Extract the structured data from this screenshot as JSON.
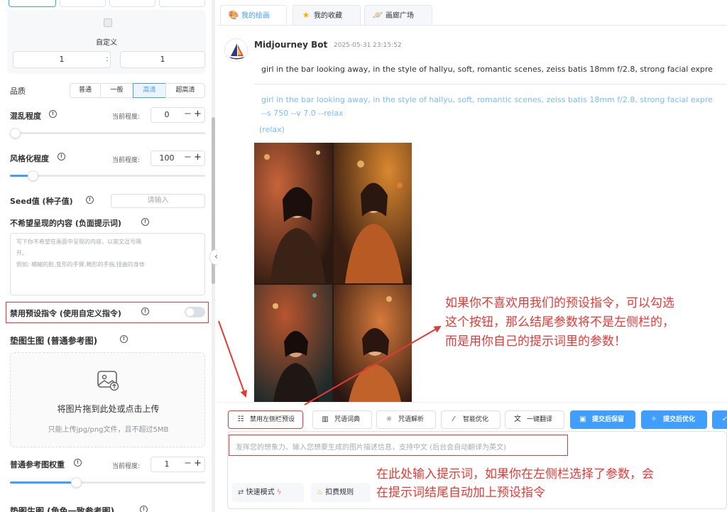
{
  "settings": {
    "custom_ratio": {
      "label": "自定义",
      "width": "1",
      "separator": ":",
      "height": "1"
    },
    "quality": {
      "label": "品质",
      "options": [
        "普通",
        "一般",
        "高清",
        "超高清"
      ],
      "selected": "高清"
    },
    "chaos": {
      "label": "混乱程度",
      "current_label": "当前程度:",
      "value": "0",
      "level": 0
    },
    "stylize": {
      "label": "风格化程度",
      "current_label": "当前程度:",
      "value": "100",
      "level": 0.1
    },
    "seed": {
      "label": "Seed值 (种子值)",
      "placeholder": "请输入"
    },
    "negative": {
      "label": "不希望呈现的内容 (负面提示词)",
      "placeholder_line1": "写下你不希望在画面中呈现的内容，以英文逗号隔",
      "placeholder_line2": "开。",
      "placeholder_line3": "例如: 模糊的脸,变形的手臂,畸形的手指,扭曲的身体"
    },
    "disable_preset": {
      "label": "禁用预设指令 (使用自定义指令)",
      "enabled": false
    },
    "ref_image": {
      "label": "垫图生图 (普通参考图)",
      "upload_title": "将图片拖到此处或点击上传",
      "upload_hint": "只能上传jpg/png文件，且不超过5MB"
    },
    "ref_weight": {
      "label": "普通参考图权重",
      "current_label": "当前程度:",
      "value": "1",
      "level": 0.33
    },
    "char_ref": {
      "label": "垫图生图 (角色一致参考图)"
    }
  },
  "tabs": [
    {
      "label": "我的绘画",
      "icon": "palette-icon",
      "active": true
    },
    {
      "label": "我的收藏",
      "icon": "star-icon",
      "active": false
    },
    {
      "label": "画廊广场",
      "icon": "planet-icon",
      "active": false
    }
  ],
  "message": {
    "author": "Midjourney Bot",
    "time": "2025-05-31 23:15:52",
    "prompt": "girl in the bar looking away, in the style of hallyu, soft, romantic scenes, zeiss batis 18mm f/2.8, strong facial expre",
    "prompt_full_line1": "girl in the bar looking away, in the style of hallyu, soft, romantic scenes, zeiss batis 18mm f/2.8, strong facial expre",
    "prompt_full_line2": "--s 750 --v 7.0 --relax",
    "mode": "(relax)"
  },
  "toolbar": {
    "disable_left_preset": "禁用左侧栏预设",
    "spell_dict": "咒语词典",
    "spell_parse": "咒语解析",
    "smart_optimize": "智能优化",
    "translate": "一键翻译",
    "submit_keep": "提交后保留",
    "submit_optimize": "提交后优化"
  },
  "composer": {
    "placeholder": "发挥您的想象力、输入您想要生成的图片描述信息，支持中文 (后台会自动翻译为英文)",
    "fast_mode": "快速模式",
    "billing": "扣费规则"
  },
  "annotations": {
    "note1_line1": "如果你不喜欢用我们的预设指令，可以勾选",
    "note1_line2": "这个按钮，那么结尾参数将不是左侧栏的，",
    "note1_line3": "而是用你自己的提示词里的参数！",
    "note2_line1": "在此处输入提示词，如果你在左侧栏选择了参数，会",
    "note2_line2": "在提示词结尾自动加上预设指令"
  },
  "colors": {
    "accent": "#409eff",
    "annotation": "#e53935"
  }
}
